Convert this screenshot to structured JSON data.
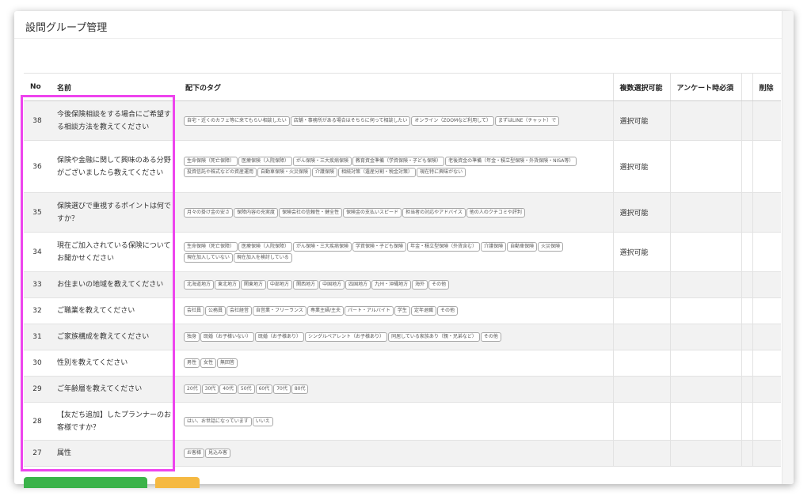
{
  "page": {
    "title": "設問グループ管理"
  },
  "table": {
    "headers": {
      "no": "No",
      "name": "名前",
      "tags": "配下のタグ",
      "multi": "複数選択可能",
      "survey": "アンケート時必須",
      "extra": "",
      "delete": "削除"
    },
    "rows": [
      {
        "no": "38",
        "name": "今後保険相談をする場合にご希望する相談方法を教えてください",
        "multi": "選択可能",
        "tags": [
          "自宅・近くのカフェ等に来てもらい相談したい",
          "店舗・事務所がある場合はそちらに伺って相談したい",
          "オンライン（ZOOMなど利用して）",
          "まずはLINE（チャット）で"
        ]
      },
      {
        "no": "36",
        "name": "保険や金融に関して興味のある分野がございましたら教えてください",
        "multi": "選択可能",
        "tags": [
          "生命保険（死亡保障）",
          "医療保険（入院保障）",
          "がん保険・三大疾病保険",
          "教育資金準備（学資保険・子ども保険）",
          "老後資金の準備（年金・積立型保険・外貨保険・NISA等）",
          "投資信託や株式などの資産運用",
          "自動車保険・火災保険",
          "介護保険",
          "相続対策（遺産分割・税金対策）",
          "現在特に興味がない"
        ]
      },
      {
        "no": "35",
        "name": "保険選びで重視するポイントは何ですか？",
        "multi": "選択可能",
        "tags": [
          "月々の掛け金の安さ",
          "保障内容の充実度",
          "保険会社の信頼性・健全性",
          "保険金の支払いスピード",
          "担当者の対応やアドバイス",
          "他の人のクチコミや評判"
        ]
      },
      {
        "no": "34",
        "name": "現在ご加入されている保険についてお聞かせください",
        "multi": "選択可能",
        "tags": [
          "生命保険（死亡保障）",
          "医療保険（入院保障）",
          "がん保険・三大疾病保険",
          "学資保険・子ども保険",
          "年金・積立型保険（外貨含む）",
          "介護保険",
          "自動車保険",
          "火災保険",
          "現在加入していない",
          "現在加入を検討している"
        ]
      },
      {
        "no": "33",
        "name": "お住まいの地域を教えてください",
        "multi": "",
        "tags": [
          "北海道地方",
          "東北地方",
          "関東地方",
          "中部地方",
          "関西地方",
          "中国地方",
          "四国地方",
          "九州・沖縄地方",
          "海外",
          "その他"
        ]
      },
      {
        "no": "32",
        "name": "ご職業を教えてください",
        "multi": "",
        "tags": [
          "会社員",
          "公務員",
          "会社経営",
          "自営業・フリーランス",
          "専業主婦/主夫",
          "パート・アルバイト",
          "学生",
          "定年退職",
          "その他"
        ]
      },
      {
        "no": "31",
        "name": "ご家族構成を教えてください",
        "multi": "",
        "tags": [
          "独身",
          "既婚（お子様いない）",
          "既婚（お子様あり）",
          "シングルペアレント（お子様あり）",
          "同居している家族あり（親・兄弟など）",
          "その他"
        ]
      },
      {
        "no": "30",
        "name": "性別を教えてください",
        "multi": "",
        "tags": [
          "男性",
          "女性",
          "無回答"
        ]
      },
      {
        "no": "29",
        "name": "ご年齢層を教えてください",
        "multi": "",
        "tags": [
          "20代",
          "30代",
          "40代",
          "50代",
          "60代",
          "70代",
          "80代"
        ]
      },
      {
        "no": "28",
        "name": "【友だち追加】したプランナーのお客様ですか？",
        "multi": "",
        "tags": [
          "はい、お世話になっています",
          "いいえ"
        ]
      },
      {
        "no": "27",
        "name": "属性",
        "multi": "",
        "tags": [
          "お客様",
          "見込み客"
        ]
      }
    ]
  },
  "colors": {
    "highlight": "#ee44ee",
    "green_button": "#3bb34a",
    "orange_button": "#f5b942"
  }
}
